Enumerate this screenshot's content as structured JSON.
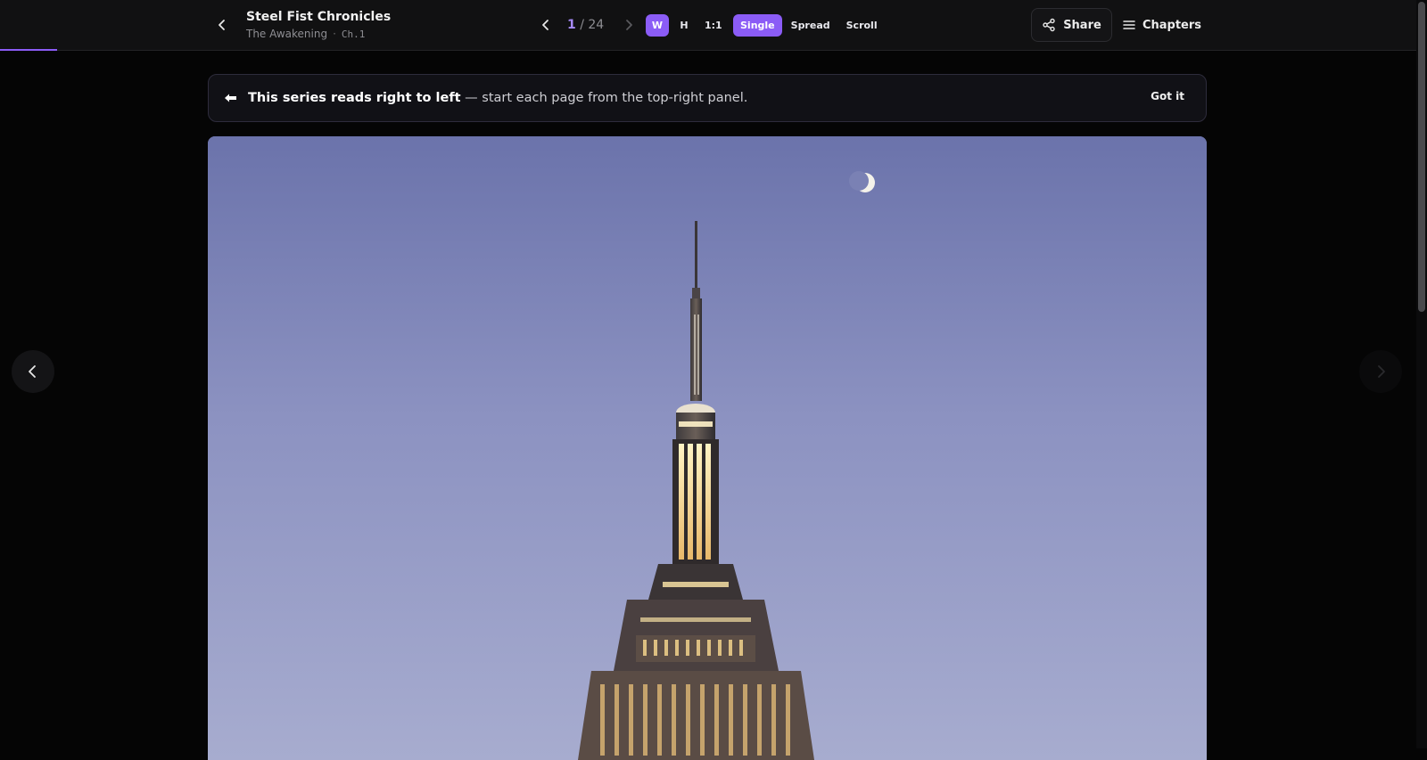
{
  "header": {
    "back_icon": "chevron-left-icon",
    "series_title": "Steel Fist Chronicles",
    "volume_title": "The Awakening",
    "separator": "·",
    "chapter_label": "Ch.1"
  },
  "pager": {
    "prev_icon": "chevron-left-icon",
    "current_page": "1",
    "total_label": "/ 24",
    "next_icon": "chevron-right-icon"
  },
  "fit_modes": [
    {
      "label": "W",
      "active": true
    },
    {
      "label": "H",
      "active": false
    },
    {
      "label": "1:1",
      "active": false
    }
  ],
  "layout_modes": [
    {
      "label": "Single",
      "active": true
    },
    {
      "label": "Spread",
      "active": false
    },
    {
      "label": "Scroll",
      "active": false
    }
  ],
  "actions": {
    "share_label": "Share",
    "share_icon": "share-icon",
    "chapters_label": "Chapters",
    "chapters_icon": "list-icon"
  },
  "reading_progress": 0.04,
  "notice": {
    "icon": "arrow-left-icon",
    "bold_text": "This series reads right to left",
    "rest_text": " — start each page from the top-right panel.",
    "dismiss_label": "Got it"
  },
  "page_image": {
    "subject": "tall skyscraper spire at dusk with crescent moon"
  },
  "side_nav": {
    "left_icon": "chevron-left-icon",
    "right_icon": "chevron-right-icon"
  },
  "colors": {
    "accent": "#8b5cf6",
    "accent_text": "#a78bfa",
    "background": "#050505",
    "toolbar": "#111112"
  }
}
